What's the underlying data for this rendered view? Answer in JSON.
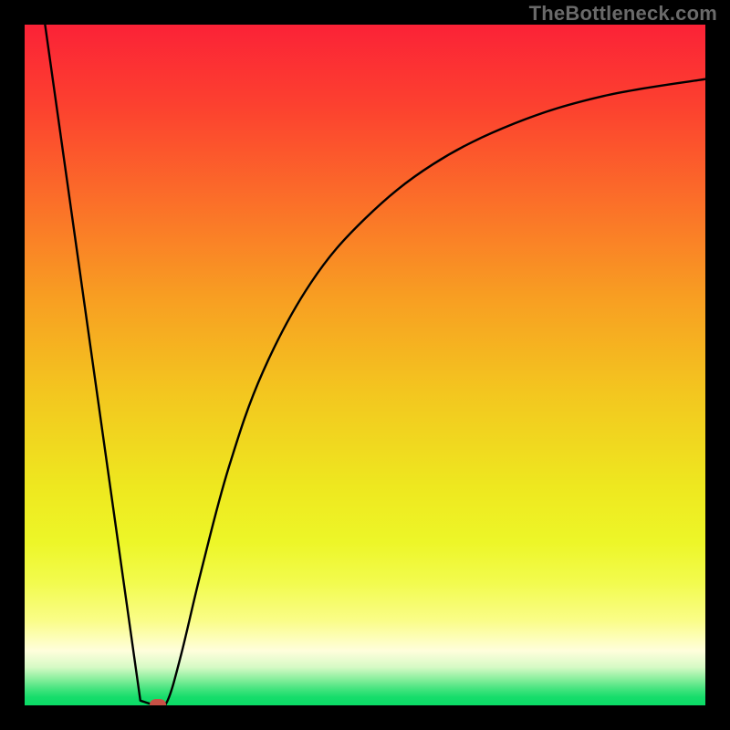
{
  "watermark": "TheBottleneck.com",
  "chart_data": {
    "type": "line",
    "title": "",
    "xlabel": "",
    "ylabel": "",
    "xlim": [
      0,
      100
    ],
    "ylim": [
      0,
      100
    ],
    "background_gradient": {
      "stops": [
        {
          "pct": 0,
          "color": "#fb2237"
        },
        {
          "pct": 12,
          "color": "#fc412f"
        },
        {
          "pct": 26,
          "color": "#fb6f29"
        },
        {
          "pct": 40,
          "color": "#f89e22"
        },
        {
          "pct": 54,
          "color": "#f3c61f"
        },
        {
          "pct": 68,
          "color": "#eee81f"
        },
        {
          "pct": 76,
          "color": "#edf628"
        },
        {
          "pct": 82,
          "color": "#f2fb4e"
        },
        {
          "pct": 87.5,
          "color": "#fafd87"
        },
        {
          "pct": 92,
          "color": "#fffedc"
        },
        {
          "pct": 94.4,
          "color": "#d6fac5"
        },
        {
          "pct": 96.2,
          "color": "#85ee9b"
        },
        {
          "pct": 97.6,
          "color": "#44e47e"
        },
        {
          "pct": 98.8,
          "color": "#16dd6b"
        },
        {
          "pct": 100,
          "color": "#0adb66"
        }
      ]
    },
    "series": [
      {
        "name": "bottleneck-curve",
        "path_points_pct": [
          {
            "x": 3.0,
            "y": 100.0
          },
          {
            "x": 17.0,
            "y": 0.7
          },
          {
            "x": 19.6,
            "y": 0.0
          },
          {
            "x": 21.0,
            "y": 0.7
          },
          {
            "x": 23.0,
            "y": 7.5
          },
          {
            "x": 26.0,
            "y": 20.0
          },
          {
            "x": 30.0,
            "y": 35.0
          },
          {
            "x": 35.0,
            "y": 49.0
          },
          {
            "x": 42.0,
            "y": 62.0
          },
          {
            "x": 50.0,
            "y": 71.5
          },
          {
            "x": 60.0,
            "y": 79.5
          },
          {
            "x": 72.0,
            "y": 85.5
          },
          {
            "x": 85.0,
            "y": 89.5
          },
          {
            "x": 100.0,
            "y": 92.0
          }
        ]
      }
    ],
    "marker": {
      "name": "optimum-dot",
      "x_pct": 19.6,
      "y_pct": 0.2,
      "color": "#c75146"
    }
  }
}
